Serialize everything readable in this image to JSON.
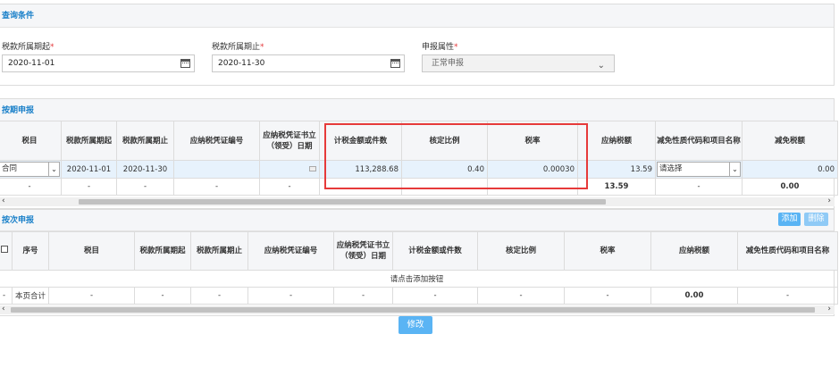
{
  "query": {
    "title": "查询条件",
    "start_label": "税款所属期起",
    "start_value": "2020-11-01",
    "end_label": "税款所属期止",
    "end_value": "2020-11-30",
    "attr_label": "申报属性",
    "attr_value": "正常申报",
    "required_mark": "*"
  },
  "periodic": {
    "title": "按期申报",
    "headers": [
      "税目",
      "税款所属期起",
      "税款所属期止",
      "应纳税凭证编号",
      "应纳税凭证书立（领受）日期",
      "计税金额或件数",
      "核定比例",
      "税率",
      "应纳税额",
      "减免性质代码和项目名称",
      "减免税额"
    ],
    "row": {
      "item": "合同",
      "start": "2020-11-01",
      "end": "2020-11-30",
      "voucher_no": "",
      "amount": "113,288.68",
      "ratio": "0.40",
      "rate": "0.00030",
      "tax": "13.59",
      "relief_code": "请选择",
      "relief_amount": "0.00"
    },
    "total": {
      "dash": "-",
      "tax": "13.59",
      "relief_amount": "0.00"
    }
  },
  "per_time": {
    "title": "按次申报",
    "add_label": "添加",
    "delete_label": "删除",
    "headers": [
      "序号",
      "税目",
      "税款所属期起",
      "税款所属期止",
      "应纳税凭证编号",
      "应纳税凭证书立（领受）日期",
      "计税金额或件数",
      "核定比例",
      "税率",
      "应纳税额",
      "减免性质代码和项目名称"
    ],
    "empty_hint": "请点击添加按钮",
    "total_label": "本页合计",
    "dash": "-",
    "tax_total": "0.00"
  },
  "modify_label": "修改",
  "colors": {
    "accent": "#1a80c9",
    "button": "#5ab4f4",
    "highlight": "#e63a3a"
  }
}
